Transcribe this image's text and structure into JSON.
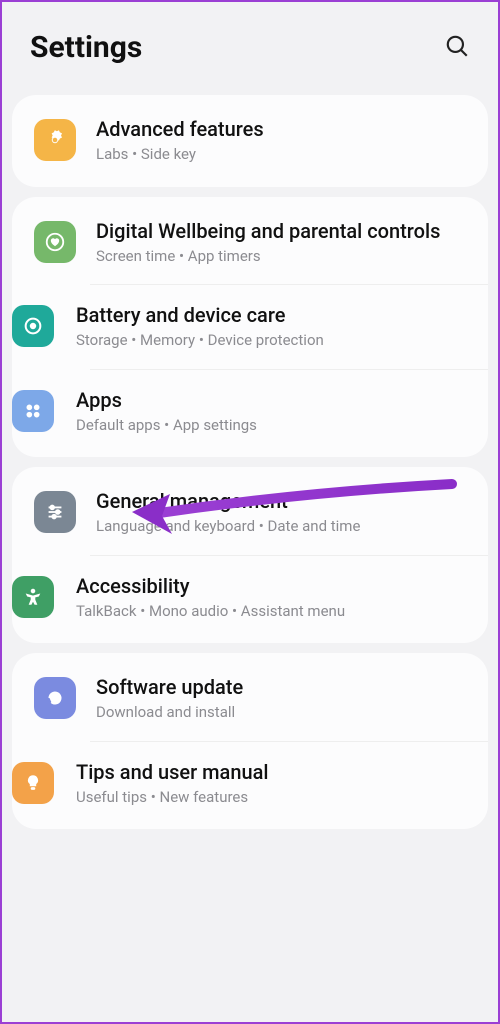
{
  "header": {
    "title": "Settings"
  },
  "groups": [
    {
      "items": [
        {
          "id": "advanced-features",
          "title": "Advanced features",
          "sub": "Labs  •  Side key",
          "color": "#f5b547",
          "icon": "gear-plus"
        }
      ]
    },
    {
      "items": [
        {
          "id": "digital-wellbeing",
          "title": "Digital Wellbeing and parental controls",
          "sub": "Screen time  •  App timers",
          "color": "#76b86a",
          "icon": "heart-circle"
        },
        {
          "id": "battery-care",
          "title": "Battery and device care",
          "sub": "Storage  •  Memory  •  Device protection",
          "color": "#1fa99a",
          "icon": "refresh-circle"
        },
        {
          "id": "apps",
          "title": "Apps",
          "sub": "Default apps  •  App settings",
          "color": "#7da8e8",
          "icon": "four-dots"
        }
      ]
    },
    {
      "items": [
        {
          "id": "general-management",
          "title": "General management",
          "sub": "Language and keyboard  •  Date and time",
          "color": "#7b8794",
          "icon": "sliders"
        },
        {
          "id": "accessibility",
          "title": "Accessibility",
          "sub": "TalkBack  •  Mono audio  •  Assistant menu",
          "color": "#3f9f65",
          "icon": "person"
        }
      ]
    },
    {
      "items": [
        {
          "id": "software-update",
          "title": "Software update",
          "sub": "Download and install",
          "color": "#7b8be0",
          "icon": "download-loop"
        },
        {
          "id": "tips",
          "title": "Tips and user manual",
          "sub": "Useful tips  •  New features",
          "color": "#f3a249",
          "icon": "lightbulb"
        }
      ]
    }
  ]
}
